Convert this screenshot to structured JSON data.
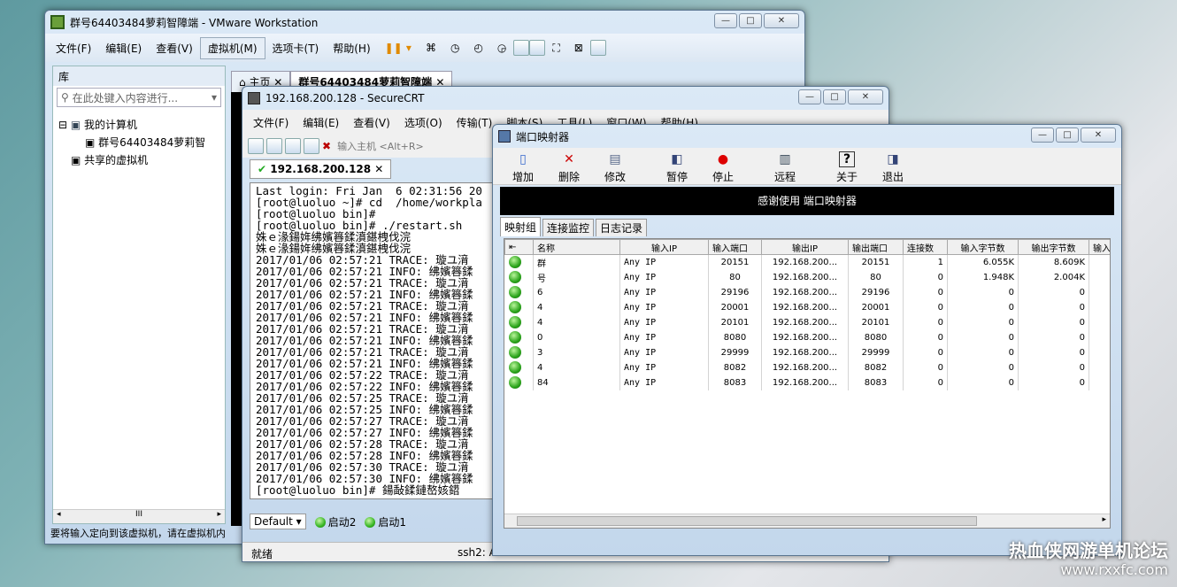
{
  "vmware": {
    "title": "群号64403484萝莉智障端 - VMware Workstation",
    "menu": [
      "文件(F)",
      "编辑(E)",
      "查看(V)",
      "虚拟机(M)",
      "选项卡(T)",
      "帮助(H)"
    ],
    "library_title": "库",
    "search_placeholder": "在此处键入内容进行...",
    "tree": {
      "root": "我的计算机",
      "vm": "群号64403484萝莉智",
      "shared": "共享的虚拟机"
    },
    "tabs": {
      "home": "主页",
      "vm": "群号64403484萝莉智障端"
    },
    "scroll_mark": "III",
    "status": "要将输入定向到该虚拟机，请在虚拟机内"
  },
  "securecrt": {
    "title": "192.168.200.128 - SecureCRT",
    "menu": [
      "文件(F)",
      "编辑(E)",
      "查看(V)",
      "选项(O)",
      "传输(T)",
      "脚本(S)",
      "工具(L)",
      "窗口(W)",
      "帮助(H)"
    ],
    "host_placeholder": "输入主机 <Alt+R>",
    "tab": "192.168.200.128",
    "terminal": [
      "Last login: Fri Jan  6 02:31:56 20",
      "[root@luoluo ~]# cd  /home/workpla",
      "[root@luoluo bin]#",
      "[root@luoluo bin]# ./restart.sh",
      "姝ｅ湪鍚姩绋嬪簭鍒濆鍖栧伐浣",
      "姝ｅ湪鍚姩绋嬪簭鍒濆鍖栧伐浣",
      "2017/01/06 02:57:21 TRACE: 璇ユ湇",
      "2017/01/06 02:57:21 INFO: 绋嬪簭鍒",
      "2017/01/06 02:57:21 TRACE: 璇ユ湇",
      "2017/01/06 02:57:21 INFO: 绋嬪簭鍒",
      "2017/01/06 02:57:21 TRACE: 璇ユ湇",
      "2017/01/06 02:57:21 INFO: 绋嬪簭鍒",
      "2017/01/06 02:57:21 TRACE: 璇ユ湇",
      "2017/01/06 02:57:21 INFO: 绋嬪簭鍒",
      "2017/01/06 02:57:21 TRACE: 璇ユ湇",
      "2017/01/06 02:57:21 INFO: 绋嬪簭鍒",
      "2017/01/06 02:57:22 TRACE: 璇ユ湇",
      "2017/01/06 02:57:22 INFO: 绋嬪簭鍒",
      "2017/01/06 02:57:25 TRACE: 璇ユ湇",
      "2017/01/06 02:57:25 INFO: 绋嬪簭鍒",
      "2017/01/06 02:57:27 TRACE: 璇ユ湇",
      "2017/01/06 02:57:27 INFO: 绋嬪簭鍒",
      "2017/01/06 02:57:28 TRACE: 璇ユ湇",
      "2017/01/06 02:57:28 INFO: 绋嬪簭鍒",
      "2017/01/06 02:57:30 TRACE: 璇ユ湇",
      "2017/01/06 02:57:30 INFO: 绋嬪簭鍒",
      "[root@luoluo bin]# 鍚敮鍒鏈嶅姟鍣"
    ],
    "session_combo": "Default",
    "btn1": "启动2",
    "btn2": "启动1",
    "status_left": "就绪",
    "status_right": "ssh2: A"
  },
  "portmap": {
    "title": "端口映射器",
    "toolbar": [
      "增加",
      "删除",
      "修改",
      "暂停",
      "停止",
      "远程",
      "关于",
      "退出"
    ],
    "banner": "感谢使用 端口映射器",
    "tabs": [
      "映射组",
      "连接监控",
      "日志记录"
    ],
    "columns": [
      "名称",
      "输入IP",
      "输入端口",
      "输出IP",
      "输出端口",
      "连接数",
      "输入字节数",
      "输出字节数",
      "输入"
    ],
    "rows": [
      [
        "群",
        "Any IP",
        "20151",
        "192.168.200...",
        "20151",
        "1",
        "6.055K",
        "8.609K"
      ],
      [
        "号",
        "Any IP",
        "80",
        "192.168.200...",
        "80",
        "0",
        "1.948K",
        "2.004K"
      ],
      [
        "6",
        "Any IP",
        "29196",
        "192.168.200...",
        "29196",
        "0",
        "0",
        "0"
      ],
      [
        "4",
        "Any IP",
        "20001",
        "192.168.200...",
        "20001",
        "0",
        "0",
        "0"
      ],
      [
        "4",
        "Any IP",
        "20101",
        "192.168.200...",
        "20101",
        "0",
        "0",
        "0"
      ],
      [
        "0",
        "Any IP",
        "8080",
        "192.168.200...",
        "8080",
        "0",
        "0",
        "0"
      ],
      [
        "3",
        "Any IP",
        "29999",
        "192.168.200...",
        "29999",
        "0",
        "0",
        "0"
      ],
      [
        "4",
        "Any IP",
        "8082",
        "192.168.200...",
        "8082",
        "0",
        "0",
        "0"
      ],
      [
        "84",
        "Any IP",
        "8083",
        "192.168.200...",
        "8083",
        "0",
        "0",
        "0"
      ]
    ]
  },
  "watermark": {
    "line1": "热血侠网游单机论坛",
    "line2": "www.rxxfc.com"
  }
}
